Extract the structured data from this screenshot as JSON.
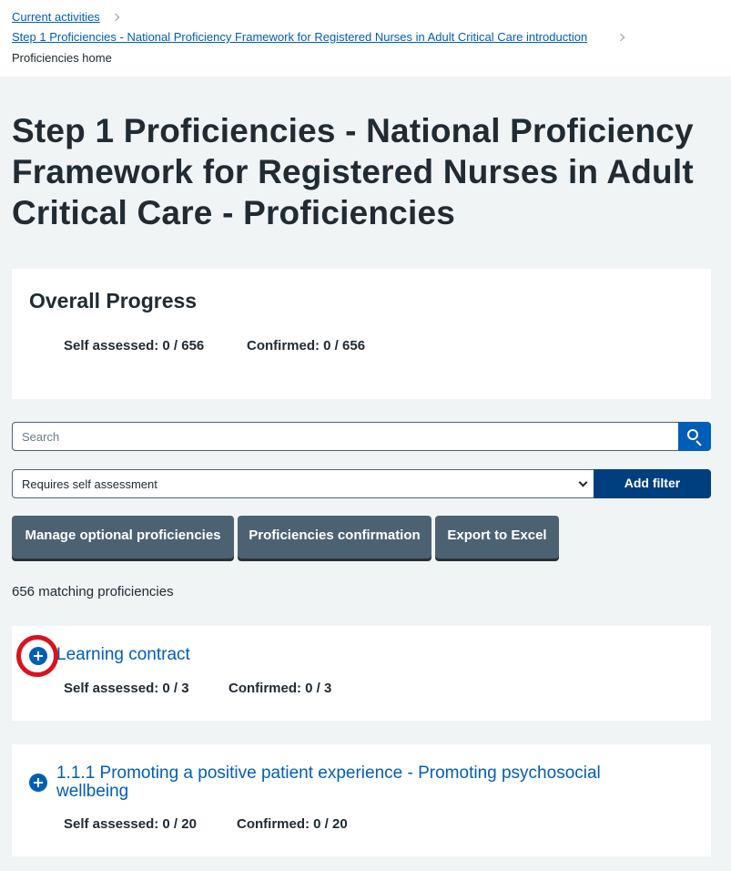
{
  "breadcrumb": {
    "items": [
      "Current activities",
      "Step 1 Proficiencies - National Proficiency Framework for Registered Nurses in Adult Critical Care introduction"
    ],
    "current": "Proficiencies home"
  },
  "page": {
    "title": "Step 1 Proficiencies - National Proficiency Framework for Registered Nurses in Adult Critical Care - Proficiencies"
  },
  "overall_progress": {
    "title": "Overall Progress",
    "self_assessed": "Self assessed: 0 / 656",
    "confirmed": "Confirmed: 0 / 656"
  },
  "search": {
    "placeholder": "Search",
    "button_icon": "search-icon"
  },
  "filter": {
    "selected": "Requires self assessment",
    "add_label": "Add filter"
  },
  "actions": [
    "Manage optional proficiencies",
    "Proficiencies confirmation",
    "Export to Excel"
  ],
  "results": {
    "count_text": "656 matching proficiencies"
  },
  "proficiencies": [
    {
      "title": "Learning contract",
      "self_assessed": "Self assessed: 0 / 3",
      "confirmed": "Confirmed: 0 / 3",
      "icon": "plus-circle-icon"
    },
    {
      "title_line1": "1.1.1 Promoting a positive patient experience - Promoting psychosocial",
      "title_line2": "wellbeing",
      "self_assessed": "Self assessed: 0 / 20",
      "confirmed": "Confirmed: 0 / 20",
      "icon": "plus-circle-icon"
    }
  ],
  "colors": {
    "link": "#005eb8",
    "page_bg": "#f0f4f5",
    "button": "#4c6272",
    "filter_button": "#003f7f",
    "highlight": "#d7141f"
  }
}
